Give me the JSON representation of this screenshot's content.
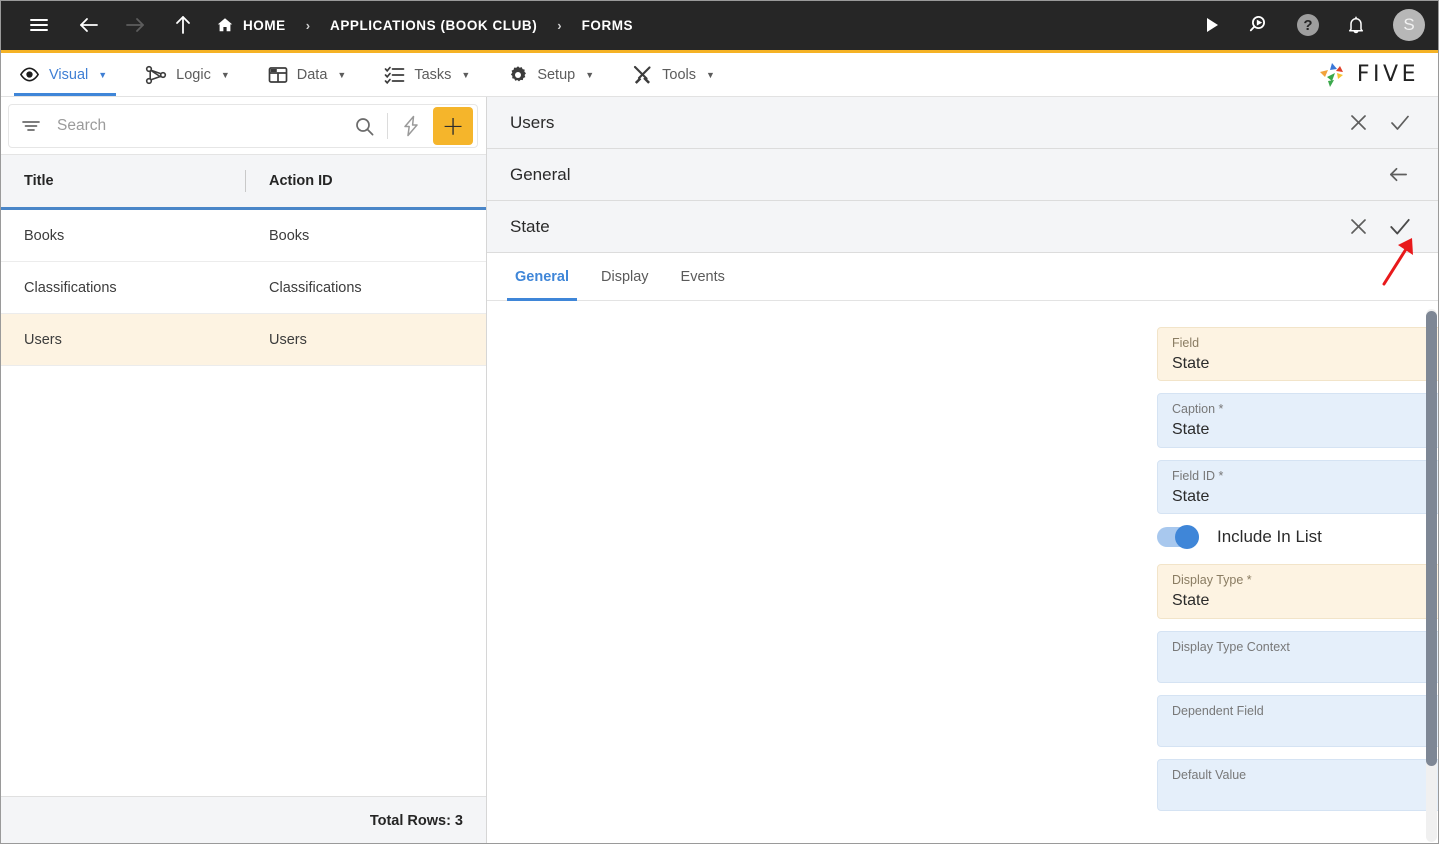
{
  "topbar": {
    "icons": [
      {
        "name": "hamburger-menu-icon",
        "glyph": "menu"
      },
      {
        "name": "back-arrow-icon",
        "glyph": "back"
      },
      {
        "name": "forward-arrow-icon",
        "glyph": "forward"
      },
      {
        "name": "up-arrow-icon",
        "glyph": "up"
      }
    ],
    "breadcrumbs": [
      {
        "label": "HOME",
        "icon": "home-icon"
      },
      {
        "label": "APPLICATIONS (BOOK CLUB)",
        "icon": ""
      },
      {
        "label": "FORMS",
        "icon": ""
      }
    ],
    "separator": "›",
    "actions": [
      {
        "name": "run-play-icon"
      },
      {
        "name": "search-run-icon"
      },
      {
        "name": "help-icon",
        "label": "?"
      },
      {
        "name": "notifications-bell-icon"
      }
    ],
    "avatar_initial": "S",
    "accent_bar_color": "#F5B225",
    "background_color": "#262626"
  },
  "menubar": {
    "items": [
      {
        "label": "Visual",
        "icon": "eye-icon",
        "caret": "▼",
        "active": true
      },
      {
        "label": "Logic",
        "icon": "nodes-icon",
        "caret": "▼",
        "active": false
      },
      {
        "label": "Data",
        "icon": "table-icon",
        "caret": "▼",
        "active": false
      },
      {
        "label": "Tasks",
        "icon": "checklist-icon",
        "caret": "▼",
        "active": false
      },
      {
        "label": "Setup",
        "icon": "gear-icon",
        "caret": "▼",
        "active": false
      },
      {
        "label": "Tools",
        "icon": "tools-icon",
        "caret": "▼",
        "active": false
      }
    ],
    "brand": "FIVE",
    "active_color": "#3f86d8"
  },
  "left_panel": {
    "search": {
      "placeholder": "Search",
      "value": ""
    },
    "toolbar": {
      "filter_icon": "filter-icon",
      "search_icon": "search-icon",
      "lightning_icon": "lightning-bolt-icon",
      "add_label": "+",
      "add_color": "#F5B52B"
    },
    "grid": {
      "columns": [
        "Title",
        "Action ID"
      ],
      "rows": [
        {
          "title": "Books",
          "action_id": "Books",
          "selected": false
        },
        {
          "title": "Classifications",
          "action_id": "Classifications",
          "selected": false
        },
        {
          "title": "Users",
          "action_id": "Users",
          "selected": true
        }
      ],
      "selected_row_color": "#FDF3E2",
      "header_underline_color": "#4a86c8",
      "footer": "Total Rows: 3"
    }
  },
  "right_panel": {
    "panes": [
      {
        "title": "Users",
        "actions": [
          "close-icon",
          "confirm-check-icon"
        ]
      },
      {
        "title": "General",
        "actions": [
          "back-arrow-icon"
        ]
      },
      {
        "title": "State",
        "actions": [
          "close-icon",
          "confirm-check-icon"
        ]
      }
    ],
    "tabs": [
      {
        "label": "General",
        "active": true
      },
      {
        "label": "Display",
        "active": false
      },
      {
        "label": "Events",
        "active": false
      }
    ],
    "fields": [
      {
        "label": "Field",
        "value": "State",
        "modified": true,
        "dropdown": true,
        "code": false,
        "help": true
      },
      {
        "label": "Caption *",
        "value": "State",
        "modified": false,
        "dropdown": false,
        "code": false,
        "help": true
      },
      {
        "label": "Field ID *",
        "value": "State",
        "modified": false,
        "dropdown": false,
        "code": false,
        "help": true
      }
    ],
    "toggle": {
      "label": "Include In List",
      "on": true,
      "help": true
    },
    "fields2": [
      {
        "label": "Display Type *",
        "value": "State",
        "modified": true,
        "dropdown": true,
        "code": true,
        "help": true
      },
      {
        "label": "Display Type Context",
        "value": "",
        "modified": false,
        "dropdown": false,
        "code": false,
        "help": true
      },
      {
        "label": "Dependent Field",
        "value": "",
        "modified": false,
        "dropdown": true,
        "code": false,
        "help": true
      },
      {
        "label": "Default Value",
        "value": "",
        "modified": false,
        "dropdown": false,
        "code": false,
        "help": true
      }
    ],
    "modified_color": "#FDF3E2",
    "field_color": "#E5EFFA"
  },
  "annotation": {
    "arrow_color": "#E8191B",
    "points_to": "confirm-check-icon"
  }
}
